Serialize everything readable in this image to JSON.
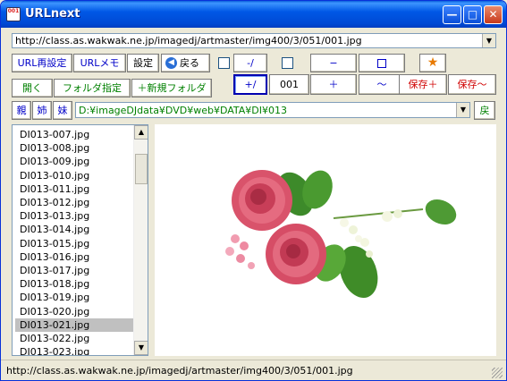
{
  "window": {
    "title": "URLnext",
    "app_icon_text": "001",
    "minimize_glyph": "—",
    "maximize_glyph": "□",
    "close_glyph": "✕"
  },
  "url_field": {
    "value": "http://class.as.wakwak.ne.jp/imagedj/artmaster/img400/3/051/001.jpg"
  },
  "toolbar_row1": {
    "reload_url": "URL再設定",
    "url_memo": "URLメモ",
    "settings": "設定",
    "back": "戻る",
    "minus_slash": "-/",
    "minus": "−",
    "star_icon": "★"
  },
  "toolbar_row2": {
    "open": "開く",
    "folder_select": "フォルダ指定",
    "new_folder": "＋新規フォルダ",
    "plus_slash": "+/",
    "digits": "001",
    "plus": "＋",
    "tilde": "〜",
    "save_plus": "保存＋",
    "save_tilde": "保存〜"
  },
  "toolbar_row3": {
    "parent": "親",
    "elder_sister": "姉",
    "younger_sister": "妹",
    "path": "D:¥imageDJdata¥DVD¥web¥DATA¥DI¥013",
    "return": "戻"
  },
  "file_list": {
    "items": [
      "DI013-007.jpg",
      "DI013-008.jpg",
      "DI013-009.jpg",
      "DI013-010.jpg",
      "DI013-011.jpg",
      "DI013-012.jpg",
      "DI013-013.jpg",
      "DI013-014.jpg",
      "DI013-015.jpg",
      "DI013-016.jpg",
      "DI013-017.jpg",
      "DI013-018.jpg",
      "DI013-019.jpg",
      "DI013-020.jpg",
      "DI013-021.jpg",
      "DI013-022.jpg",
      "DI013-023.jpg"
    ],
    "selected": "DI013-021.jpg"
  },
  "status": {
    "text": "http://class.as.wakwak.ne.jp/imagedj/artmaster/img400/3/051/001.jpg"
  },
  "colors": {
    "titlebar": "#0058e6",
    "accent_blue": "#0000c8",
    "accent_green": "#008000",
    "accent_red": "#d00000",
    "selection": "#c0c0c0"
  }
}
